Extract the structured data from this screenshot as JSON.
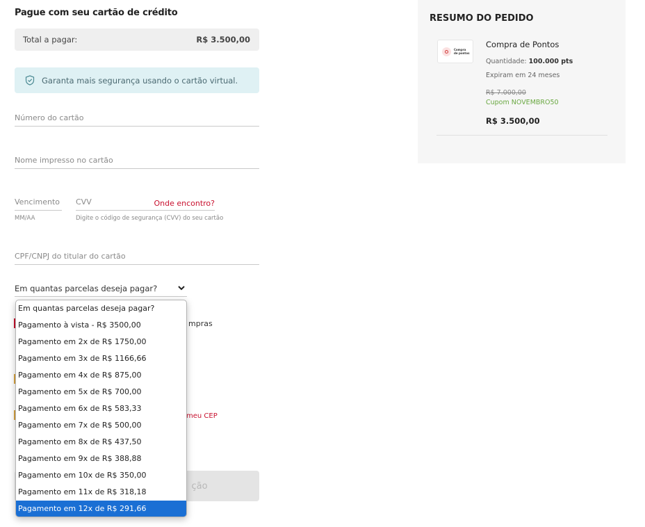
{
  "payment": {
    "heading": "Pague com seu cartão de crédito",
    "total_label": "Total a pagar:",
    "total_value": "R$ 3.500,00",
    "security_notice": "Garanta mais segurança usando o cartão virtual.",
    "card_number_placeholder": "Número do cartão",
    "card_name_placeholder": "Nome impresso no cartão",
    "expiry_placeholder": "Vencimento",
    "expiry_helper": "MM/AA",
    "cvv_placeholder": "CVV",
    "cvv_link": "Onde encontro?",
    "cvv_helper": "Digite o código de segurança (CVV) do seu cartão",
    "document_placeholder": "CPF/CNPJ do titular do cartão",
    "installments_label": "Em quantas parcelas deseja pagar?",
    "hidden_fragments": {
      "compras": "mpras",
      "cep_link": "meu CEP",
      "button_tail": "ção"
    }
  },
  "installments_dropdown": {
    "options": [
      "Em quantas parcelas deseja pagar?",
      "Pagamento à vista - R$ 3500,00",
      "Pagamento em 2x de R$ 1750,00",
      "Pagamento em 3x de R$ 1166,66",
      "Pagamento em 4x de R$ 875,00",
      "Pagamento em 5x de R$ 700,00",
      "Pagamento em 6x de R$ 583,33",
      "Pagamento em 7x de R$ 500,00",
      "Pagamento em 8x de R$ 437,50",
      "Pagamento em 9x de R$ 388,88",
      "Pagamento em 10x de R$ 350,00",
      "Pagamento em 11x de R$ 318,18",
      "Pagamento em 12x de R$ 291,66"
    ],
    "selected_index": 12
  },
  "summary": {
    "title": "RESUMO DO PEDIDO",
    "product_image_text": "Compra de pontos",
    "product_name": "Compra de Pontos",
    "quantity_label": "Quantidade:",
    "quantity_value": "100.000 pts",
    "expiration": "Expiram em 24 meses",
    "old_price": "R$ 7.000,00",
    "coupon": "Cupom NOVEMBRO50",
    "new_price": "R$ 3.500,00"
  },
  "colors": {
    "accent_red": "#c8102e",
    "info_bg": "#dff1f4",
    "selected_option": "#1a6fd4",
    "coupon_green": "#6aa842"
  }
}
